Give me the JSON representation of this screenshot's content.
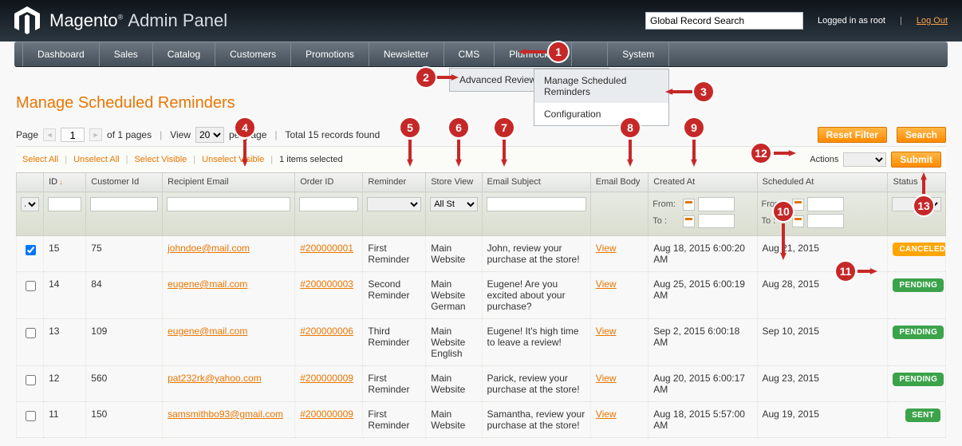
{
  "header": {
    "brand": "Magento",
    "brand_sub": "Admin Panel",
    "search_placeholder": "Global Record Search",
    "logged_in_text": "Logged in as root",
    "logout": "Log Out"
  },
  "nav": {
    "items": [
      "Dashboard",
      "Sales",
      "Catalog",
      "Customers",
      "Promotions",
      "Newsletter",
      "CMS",
      "Plumrocket",
      "",
      "System"
    ]
  },
  "dropdown": {
    "parent": "Advanced Reviews & Reminders",
    "children": [
      "Manage Scheduled Reminders",
      "Configuration"
    ]
  },
  "page_title": "Manage Scheduled Reminders",
  "pager": {
    "page_label": "Page",
    "page_value": "1",
    "of_pages": "of 1 pages",
    "view_label": "View",
    "per_page_value": "20",
    "per_page_suffix": "per page",
    "total": "Total 15 records found"
  },
  "buttons": {
    "reset_filter": "Reset Filter",
    "search": "Search",
    "submit": "Submit"
  },
  "selbar": {
    "select_all": "Select All",
    "unselect_all": "Unselect All",
    "select_visible": "Select Visible",
    "unselect_visible": "Unselect Visible",
    "items_selected": "1 items selected",
    "actions_label": "Actions"
  },
  "columns": [
    "",
    "ID",
    "Customer Id",
    "Recipient Email",
    "Order ID",
    "Reminder",
    "Store View",
    "Email Subject",
    "Email Body",
    "Created At",
    "Scheduled At",
    "Status"
  ],
  "filters": {
    "any": "Any",
    "all_store": "All St",
    "from": "From:",
    "to": "To :"
  },
  "rows": [
    {
      "checked": true,
      "id": "15",
      "customer": "75",
      "email": "johndoe@mail.com",
      "order": "#200000001",
      "reminder": "First Reminder",
      "store": "Main Website",
      "subject": "John, review your purchase at the store!",
      "body": "View",
      "created": "Aug 18, 2015 6:00:20 AM",
      "scheduled": "Aug 21, 2015",
      "status": "CANCELED",
      "status_class": "st-canceled"
    },
    {
      "checked": false,
      "id": "14",
      "customer": "84",
      "email": "eugene@mail.com",
      "order": "#200000003",
      "reminder": "Second Reminder",
      "store": "Main Website German",
      "subject": "Eugene! Are you excited about your purchase?",
      "body": "View",
      "created": "Aug 25, 2015 6:00:19 AM",
      "scheduled": "Aug 28, 2015",
      "status": "PENDING",
      "status_class": "st-pending"
    },
    {
      "checked": false,
      "id": "13",
      "customer": "109",
      "email": "eugene@mail.com",
      "order": "#200000006",
      "reminder": "Third Reminder",
      "store": "Main Website English",
      "subject": "Eugene! It's high time to leave a review!",
      "body": "View",
      "created": "Sep 2, 2015 6:00:18 AM",
      "scheduled": "Sep 10, 2015",
      "status": "PENDING",
      "status_class": "st-pending"
    },
    {
      "checked": false,
      "id": "12",
      "customer": "560",
      "email": "pat232rk@yahoo.com",
      "order": "#200000009",
      "reminder": "First Reminder",
      "store": "Main Website",
      "subject": "Parick, review your purchase at the store!",
      "body": "View",
      "created": "Aug 20, 2015 6:00:17 AM",
      "scheduled": "Aug 23, 2015",
      "status": "PENDING",
      "status_class": "st-pending"
    },
    {
      "checked": false,
      "id": "11",
      "customer": "150",
      "email": "samsmithbo93@gmail.com",
      "order": "#200000009",
      "reminder": "First Reminder",
      "store": "Main Website",
      "subject": "Samantha, review your purchase at the store!",
      "body": "View",
      "created": "Aug 18, 2015 5:57:00 AM",
      "scheduled": "Aug 19, 2015",
      "status": "SENT",
      "status_class": "st-sent"
    }
  ],
  "annotations": [
    "1",
    "2",
    "3",
    "4",
    "5",
    "6",
    "7",
    "8",
    "9",
    "10",
    "11",
    "12",
    "13"
  ]
}
